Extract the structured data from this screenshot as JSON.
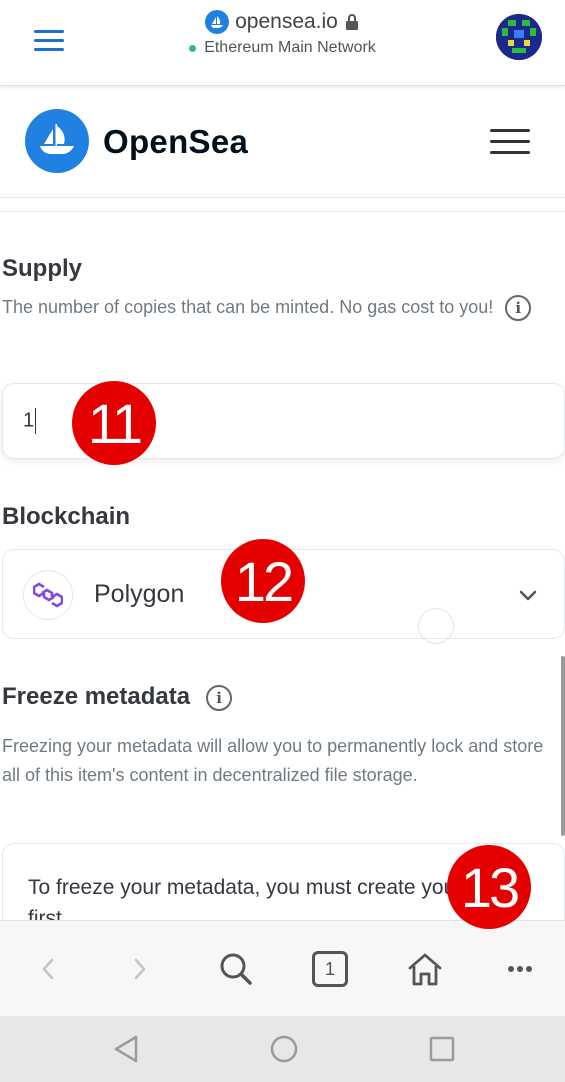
{
  "browser": {
    "url": "opensea.io",
    "network": "Ethereum Main Network"
  },
  "header": {
    "brand": "OpenSea"
  },
  "supply": {
    "title": "Supply",
    "description": "The number of copies that can be minted. No gas cost to you!",
    "value": "1"
  },
  "blockchain": {
    "title": "Blockchain",
    "selected": "Polygon"
  },
  "freeze": {
    "title": "Freeze metadata",
    "description": "Freezing your metadata will allow you to permanently lock and store all of this item's content in decentralized file storage.",
    "notice": "To freeze your metadata, you must create your item first."
  },
  "toolbar": {
    "tab_count": "1"
  },
  "markers": [
    "11",
    "12",
    "13"
  ],
  "colors": {
    "accent": "#2081e2",
    "marker": "#e50000",
    "browser_accent": "#1f6fd1"
  }
}
